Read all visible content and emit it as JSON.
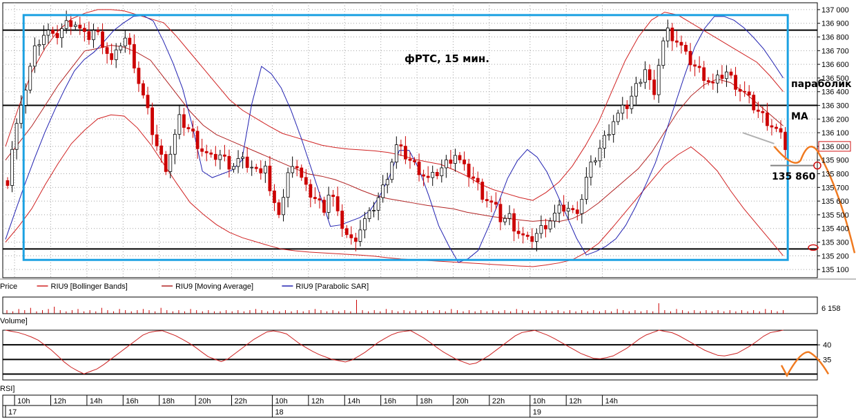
{
  "chart_data": {
    "type": "candlestick",
    "title": "фРТС,  15 мин.",
    "ylim": [
      135050,
      137040
    ],
    "y_ticks": [
      135100,
      135200,
      135300,
      135400,
      135500,
      135600,
      135700,
      135800,
      135900,
      136000,
      136100,
      136200,
      136300,
      136400,
      136500,
      136600,
      136700,
      136800,
      136900,
      137000
    ],
    "y_tick_labels": [
      "135 100",
      "135 200",
      "135 300",
      "135 400",
      "135 500",
      "135 600",
      "135 700",
      "135 800",
      "135 900",
      "136 000",
      "136 100",
      "136 200",
      "136 300",
      "136 400",
      "136 500",
      "136 600",
      "136 700",
      "136 800",
      "136 900",
      "137 000"
    ],
    "current_price_label": "136 000",
    "current_price": 136000,
    "horizontal_levels": [
      136850,
      136300,
      135250
    ],
    "range_box": {
      "price_top": 136960,
      "price_bottom": 135170,
      "bar_start": 4,
      "bar_end": 173
    },
    "x_time_ticks": [
      {
        "label": "10h",
        "bar": 2
      },
      {
        "label": "12h",
        "bar": 10
      },
      {
        "label": "14h",
        "bar": 18
      },
      {
        "label": "16h",
        "bar": 26
      },
      {
        "label": "18h",
        "bar": 34
      },
      {
        "label": "20h",
        "bar": 42
      },
      {
        "label": "22h",
        "bar": 50
      },
      {
        "label": "10h",
        "bar": 59
      },
      {
        "label": "12h",
        "bar": 67
      },
      {
        "label": "14h",
        "bar": 75
      },
      {
        "label": "16h",
        "bar": 83
      },
      {
        "label": "18h",
        "bar": 91
      },
      {
        "label": "20h",
        "bar": 99
      },
      {
        "label": "22h",
        "bar": 107
      },
      {
        "label": "10h",
        "bar": 116
      },
      {
        "label": "12h",
        "bar": 124
      },
      {
        "label": "14h",
        "bar": 132
      }
    ],
    "x_date_ticks": [
      {
        "label": "17",
        "bar": 0
      },
      {
        "label": "18",
        "bar": 59
      },
      {
        "label": "19",
        "bar": 116
      }
    ],
    "close_path": [
      135750,
      136100,
      136250,
      136500,
      136700,
      136800,
      136850,
      136780,
      136850,
      136900,
      136920,
      136850,
      136780,
      136850,
      136800,
      136700,
      136600,
      136750,
      136800,
      136650,
      136450,
      136300,
      136100,
      135950,
      135850,
      136000,
      136200,
      136150,
      136100,
      136000,
      135950,
      135900,
      135950,
      135900,
      135850,
      135900,
      135880,
      135850,
      135800,
      135900,
      135600,
      135500,
      135650,
      135900,
      135850,
      135700,
      135650,
      135600,
      135550,
      135700,
      135500,
      135400,
      135300,
      135350,
      135450,
      135500,
      135600,
      135700,
      135850,
      136000,
      135950,
      135900,
      135850,
      135800,
      135750,
      135800,
      135850,
      135900,
      135950,
      135850,
      135800,
      135750,
      135650,
      135600,
      135550,
      135450,
      135500,
      135400,
      135350,
      135300,
      135350,
      135400,
      135450,
      135500,
      135550,
      135550,
      135500,
      135600,
      135800,
      135900,
      136000,
      136100,
      136200,
      136250,
      136300,
      136400,
      136500,
      136600,
      136300,
      136700,
      136850,
      136800,
      136750,
      136650,
      136600,
      136550,
      136500,
      136450,
      136500,
      136550,
      136480,
      136420,
      136380,
      136300,
      136250,
      136200,
      136150,
      136100,
      136000
    ],
    "ma_path": [
      135900,
      136050,
      136200,
      136400,
      136550,
      136700,
      136720,
      136750,
      136700,
      136650,
      136500,
      136350,
      136200,
      136100,
      136050,
      136000,
      135950,
      135900,
      135850,
      135800,
      135780,
      135750,
      135700,
      135650,
      135620,
      135600,
      135580,
      135560,
      135550,
      135520,
      135500,
      135480,
      135470,
      135450,
      135460,
      135450,
      135480,
      135550,
      135650,
      135750,
      135850,
      136000,
      136200,
      136350,
      136450,
      136500,
      136450,
      136350,
      136250,
      136150
    ],
    "bb_upper_path": [
      136000,
      136500,
      136800,
      136950,
      137000,
      137000,
      136950,
      136900,
      136700,
      136500,
      136300,
      136200,
      136100,
      136050,
      136000,
      135980,
      135970,
      135950,
      135900,
      135870,
      135800,
      135700,
      135650,
      135600,
      135700,
      135900,
      136200,
      136600,
      136900,
      137000,
      136900,
      136800,
      136700,
      136600,
      136400
    ],
    "bb_lower_path": [
      135300,
      135500,
      135800,
      136050,
      136200,
      136250,
      136100,
      135850,
      135600,
      135450,
      135350,
      135300,
      135250,
      135230,
      135220,
      135210,
      135200,
      135180,
      135170,
      135160,
      135150,
      135140,
      135130,
      135120,
      135140,
      135180,
      135300,
      135500,
      135700,
      135900,
      136000,
      135850,
      135600,
      135400,
      135200
    ],
    "sar_path": [
      135320,
      135700,
      136050,
      136350,
      136600,
      136700,
      136850,
      136950,
      136960,
      136700,
      136350,
      135750,
      135800,
      135850,
      136600,
      136500,
      136200,
      135800,
      135400,
      135450,
      135500,
      135700,
      136050,
      135800,
      135400,
      135150,
      135200,
      135500,
      135850,
      136000,
      135800,
      135500,
      135200,
      135250,
      135350,
      135600,
      135900,
      136300,
      136700,
      136950,
      136950,
      136850,
      136700,
      136500
    ],
    "legend_items": [
      {
        "label": "Price",
        "color": "#000000"
      },
      {
        "label": "RIU9 [Bollinger Bands]",
        "color": "#d02020"
      },
      {
        "label": "RIU9 [Moving Average]",
        "color": "#b02020"
      },
      {
        "label": "RIU9 [Parabolic SAR]",
        "color": "#2020b0"
      }
    ],
    "volume": {
      "label": "Volume]",
      "value_label": "6 158",
      "values": [
        3,
        2,
        4,
        3,
        5,
        2,
        3,
        4,
        6,
        3,
        2,
        3,
        4,
        2,
        3,
        2,
        5,
        3,
        2,
        4,
        3,
        2,
        3,
        4,
        3,
        2,
        5,
        3,
        2,
        3,
        2,
        4,
        3,
        2,
        3,
        2,
        2,
        3,
        2,
        3,
        2,
        3,
        4,
        3,
        2,
        3,
        2,
        3,
        2,
        3,
        2,
        3,
        4,
        3,
        2,
        3,
        2,
        3,
        2,
        12,
        3,
        2,
        3,
        2,
        4,
        3,
        2,
        3,
        2,
        3,
        2,
        3,
        2,
        3,
        2,
        4,
        3,
        2,
        3,
        2,
        3,
        2,
        3,
        2,
        3,
        2,
        4,
        3,
        2,
        3,
        2,
        3,
        2,
        3,
        2,
        3,
        2,
        3,
        2,
        3,
        2,
        3,
        2,
        4,
        3,
        2,
        3,
        2,
        3,
        2,
        9,
        3,
        2,
        4,
        3,
        2,
        3,
        2,
        3,
        2,
        3,
        2,
        3,
        2,
        3,
        2,
        3,
        2,
        4,
        3,
        2,
        3
      ]
    },
    "rsi": {
      "label": "RSI]",
      "ylim": [
        28,
        45
      ],
      "levels": [
        40,
        35,
        30
      ],
      "tick_labels": [
        "40",
        "35"
      ],
      "tick_values": [
        40,
        35
      ],
      "path": [
        45,
        44,
        42,
        38,
        33,
        30,
        32,
        36,
        40,
        44,
        45,
        43,
        40,
        36,
        34,
        38,
        42,
        45,
        44,
        40,
        37,
        35,
        34,
        37,
        41,
        44,
        45,
        42,
        38,
        35,
        33,
        36,
        40,
        44,
        45,
        43,
        40,
        37,
        35,
        36,
        39,
        43,
        45,
        44,
        41,
        38,
        36,
        37,
        40,
        44,
        45
      ]
    },
    "annotations": {
      "parabolic": "параболик",
      "ma": "MA",
      "level_label": "135 860",
      "level_value": 135860
    }
  }
}
